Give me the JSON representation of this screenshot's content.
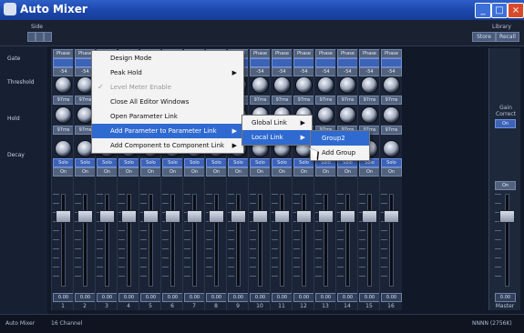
{
  "window": {
    "title": "Auto Mixer"
  },
  "topbar": {
    "side_label": "Side",
    "library_label": "Library",
    "store_button": "Store",
    "recall_button": "Recall"
  },
  "row_labels": [
    "Gate",
    "Threshold",
    "Hold",
    "Decay"
  ],
  "channels": [
    {
      "num": "1"
    },
    {
      "num": "2"
    },
    {
      "num": "3"
    },
    {
      "num": "4"
    },
    {
      "num": "5"
    },
    {
      "num": "6"
    },
    {
      "num": "7"
    },
    {
      "num": "8"
    },
    {
      "num": "9"
    },
    {
      "num": "10"
    },
    {
      "num": "11"
    },
    {
      "num": "12"
    },
    {
      "num": "13"
    },
    {
      "num": "14"
    },
    {
      "num": "15"
    },
    {
      "num": "16"
    }
  ],
  "channel_common": {
    "phase": "Phase",
    "threshold_value": "-54",
    "ms_value": "97ms",
    "solo": "Solo",
    "on": "On",
    "fader_value": "0.00"
  },
  "master": {
    "label": "Master",
    "gain_label": "Gain Correct",
    "on": "On",
    "fader_value": "0.00"
  },
  "context_menu": {
    "items": [
      "Design Mode",
      "Peak Hold",
      "Level Meter Enable",
      "Close All Editor Windows",
      "Open Parameter Link",
      "Add Parameter to Parameter Link",
      "Add Component to Component Link"
    ],
    "checked_index": 2,
    "disabled_index": 2,
    "highlight_index": 5
  },
  "submenu1": {
    "items": [
      "Global Link",
      "Local Link"
    ],
    "highlight_index": 1
  },
  "submenu2": {
    "items": [
      "Group2",
      "Add Group"
    ],
    "highlight_index": 0
  },
  "statusbar": {
    "left": "Auto Mixer",
    "channels": "16 Channel",
    "right": "NNNN (2756K)"
  }
}
